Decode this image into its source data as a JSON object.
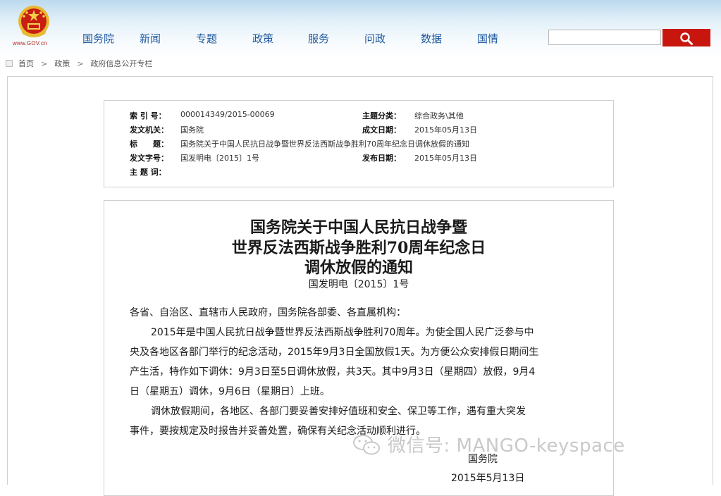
{
  "header": {
    "logo_url": "www.GOV.cn",
    "nav": [
      "国务院",
      "新闻",
      "专题",
      "政策",
      "服务",
      "问政",
      "数据",
      "国情"
    ],
    "search": {
      "value": "",
      "placeholder": ""
    }
  },
  "breadcrumb": {
    "items": [
      "首页",
      "政策",
      "政府信息公开专栏"
    ],
    "separator": ">"
  },
  "meta": {
    "index_label": "索 引 号：",
    "index_value": "000014349/2015-00069",
    "category_label": "主题分类：",
    "category_value": "综合政务\\其他",
    "issuer_label": "发文机关：",
    "issuer_value": "国务院",
    "written_date_label": "成文日期：",
    "written_date_value": "2015年05月13日",
    "title_label": "标　　题：",
    "title_value": "国务院关于中国人民抗日战争暨世界反法西斯战争胜利70周年纪念日调休放假的通知",
    "doc_number_label": "发文字号：",
    "doc_number_value": "国发明电〔2015〕1号",
    "publish_date_label": "发布日期：",
    "publish_date_value": "2015年05月13日",
    "keywords_label": "主 题 词：",
    "keywords_value": ""
  },
  "document": {
    "title_lines": [
      "国务院关于中国人民抗日战争暨",
      "世界反法西斯战争胜利70周年纪念日",
      "调休放假的通知"
    ],
    "doc_number": "国发明电〔2015〕1号",
    "body_lines": [
      "各省、自治区、直辖市人民政府，国务院各部委、各直属机构：",
      "2015年是中国人民抗日战争暨世界反法西斯战争胜利70周年。为使全国人民广泛参与中",
      "央及各地区各部门举行的纪念活动，2015年9月3日全国放假1天。为方便公众安排假日期间生",
      "产生活，特作如下调休：9月3日至5日调休放假，共3天。其中9月3日（星期四）放假，9月4",
      "日（星期五）调休，9月6日（星期日）上班。",
      "调休放假期间，各地区、各部门要妥善安排好值班和安全、保卫等工作，遇有重大突发",
      "事件，要按规定及时报告并妥善处置，确保有关纪念活动顺利进行。"
    ],
    "signature": "国务院",
    "date": "2015年5月13日"
  },
  "watermark": {
    "text": "微信号: MANGO-keyspace"
  },
  "colors": {
    "nav_text": "#1f5aa0",
    "search_button": "#c8160f",
    "emblem_red": "#c81e12",
    "emblem_gold": "#e8b931"
  }
}
